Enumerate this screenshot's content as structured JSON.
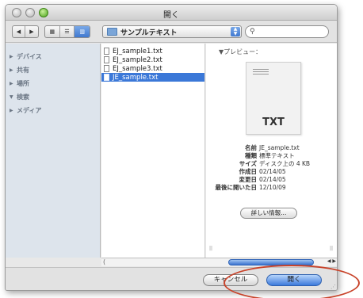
{
  "window": {
    "title": "開く"
  },
  "toolbar": {
    "folder": "サンプルテキスト",
    "search_placeholder": ""
  },
  "sidebar": {
    "items": [
      {
        "label": "デバイス",
        "expanded": false
      },
      {
        "label": "共有",
        "expanded": false
      },
      {
        "label": "場所",
        "expanded": false
      },
      {
        "label": "検索",
        "expanded": true
      },
      {
        "label": "メディア",
        "expanded": false
      }
    ]
  },
  "files": [
    {
      "name": "EJ_sample1.txt",
      "selected": false
    },
    {
      "name": "EJ_sample2.txt",
      "selected": false
    },
    {
      "name": "EJ_sample3.txt",
      "selected": false
    },
    {
      "name": "JE_sample.txt",
      "selected": true
    }
  ],
  "preview": {
    "heading": "▼プレビュー：",
    "thumb_label": "TXT",
    "info": [
      {
        "key": "名前",
        "value": "JE_sample.txt"
      },
      {
        "key": "種類",
        "value": "標準テキスト"
      },
      {
        "key": "サイズ",
        "value": "ディスク上の 4 KB"
      },
      {
        "key": "作成日",
        "value": "02/14/05"
      },
      {
        "key": "変更日",
        "value": "02/14/05"
      },
      {
        "key": "最後に開いた日",
        "value": "12/10/09"
      }
    ],
    "more_label": "詳しい情報..."
  },
  "buttons": {
    "cancel": "キャンセル",
    "open": "開く"
  },
  "colors": {
    "selection": "#3b78d8",
    "annotation": "#c8432a"
  }
}
